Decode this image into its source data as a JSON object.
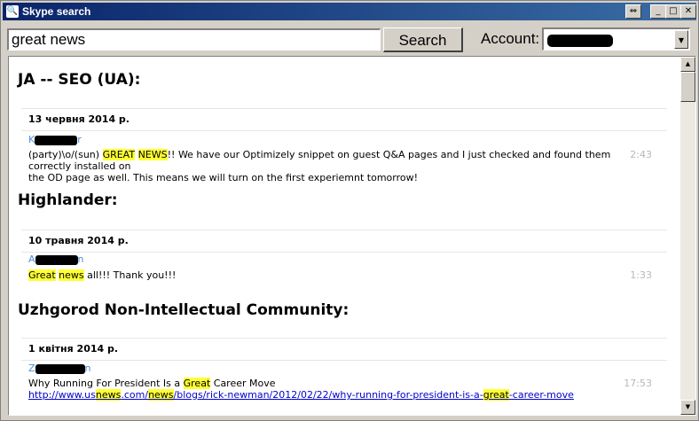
{
  "window": {
    "title": "Skype search"
  },
  "toolbar": {
    "search_value": "great news",
    "search_button": "Search",
    "account_label": "Account:"
  },
  "results": [
    {
      "group": "JA -- SEO (UA):",
      "date": "13 червня 2014 р.",
      "sender_visible_start": "K",
      "sender_visible_end": "r",
      "time": "2:43",
      "message_parts": [
        "(party)\\o/(sun) ",
        "GREAT",
        " ",
        "NEWS",
        "!! We have our Optimizely snippet on guest Q&A pages and I just checked and found them correctly installed on",
        "the OD page as well. This means we will turn on the first experiemnt tomorrow!"
      ]
    },
    {
      "group": "Highlander:",
      "date": "10 травня 2014 р.",
      "sender_visible_start": "A",
      "sender_visible_end": "n",
      "time": "1:33",
      "message_parts": [
        "Great",
        " ",
        "news",
        " all!!! Thank you!!!"
      ]
    },
    {
      "group": "Uzhgorod Non-Intellectual Community:",
      "date": "1 квітня 2014 р.",
      "sender_visible_start": "Z",
      "sender_visible_end": "n",
      "time": "17:53",
      "message_parts": [
        "Why Running For President Is a ",
        "Great",
        " Career Move"
      ],
      "link_parts": [
        "http://www.us",
        "news",
        ".com/",
        "news",
        "/blogs/rick-newman/2012/02/22/why-running-for-president-is-a-",
        "great",
        "-career-move"
      ]
    }
  ]
}
